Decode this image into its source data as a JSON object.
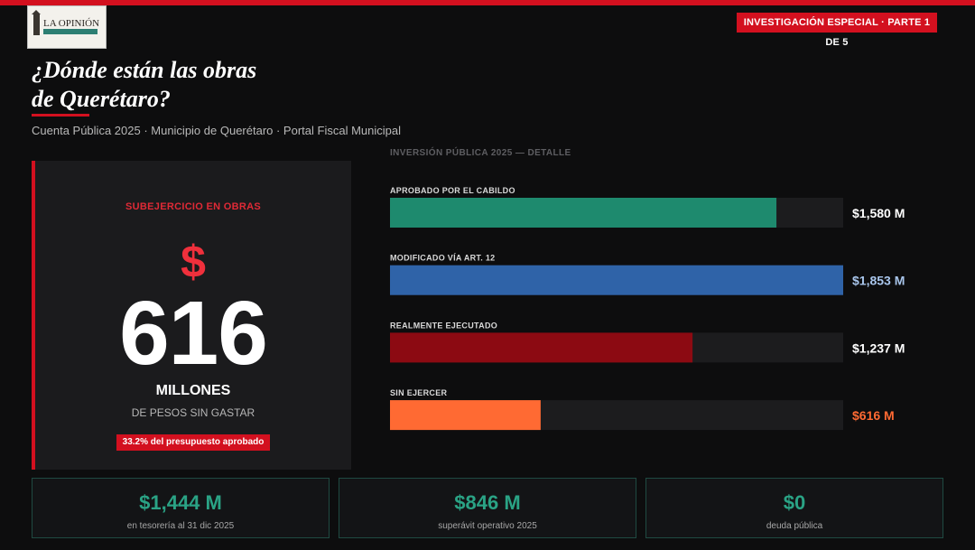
{
  "header": {
    "logo_text": "LA OPINIÓN",
    "badge": "INVESTIGACIÓN ESPECIAL · PARTE 1 DE 5",
    "title_line1": "¿Dónde están las obras",
    "title_line2": "de Querétaro?",
    "subtitle": "Cuenta Pública 2025 · Municipio de Querétaro · Portal Fiscal Municipal"
  },
  "main_card": {
    "label": "SUBEJERCICIO EN OBRAS",
    "currency_symbol": "$",
    "number": "616",
    "units": "MILLONES",
    "description": "DE PESOS SIN GASTAR",
    "pill": "33.2% del presupuesto aprobado"
  },
  "chart_data": {
    "type": "bar",
    "orientation": "horizontal",
    "title": "INVERSIÓN PÚBLICA 2025 — DETALLE",
    "unit": "M",
    "xlim": [
      0,
      1853
    ],
    "grid": false,
    "categories": [
      "APROBADO POR EL CABILDO",
      "MODIFICADO VÍA ART. 12",
      "REALMENTE EJECUTADO",
      "SIN EJERCER"
    ],
    "values": [
      1580,
      1853,
      1237,
      616
    ],
    "value_labels": [
      "$1,580 M",
      "$1,853 M",
      "$1,237 M",
      "$616 M"
    ],
    "colors": [
      "#1e8a6e",
      "#2f63a8",
      "#8c0a12",
      "#ff6a33"
    ],
    "label_colors": [
      "#ffffff",
      "#a9c6ec",
      "#ffffff",
      "#ff6a33"
    ]
  },
  "stats": [
    {
      "value": "$1,444 M",
      "label": "en tesorería al 31 dic 2025"
    },
    {
      "value": "$846 M",
      "label": "superávit operativo 2025"
    },
    {
      "value": "$0",
      "label": "deuda pública"
    }
  ],
  "colors": {
    "accent": "#d3101f",
    "background": "#0d0d0e",
    "card": "#1b1b1d",
    "stat_value": "#2aa385"
  }
}
